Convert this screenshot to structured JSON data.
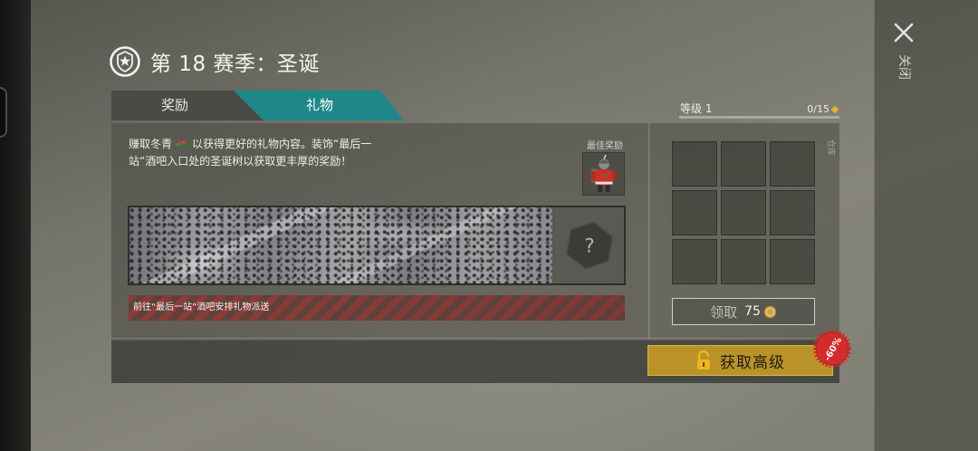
{
  "window": {
    "close_label": "关闭"
  },
  "header": {
    "title": "第 18 赛季：圣诞"
  },
  "tabs": [
    {
      "label": "奖励",
      "active": false
    },
    {
      "label": "礼物",
      "active": true
    }
  ],
  "gift": {
    "description_line1_before_icon": "赚取冬青",
    "description_line1_after_icon": "以获得更好的礼物内容。装饰“最后一",
    "description_line2": "站”酒吧入口处的圣诞树以获取更丰厚的奖励！",
    "best_reward_label": "最佳奖励",
    "mystery_symbol": "?",
    "delivery_notice": "前往“最后一站”酒吧安排礼物派送"
  },
  "level": {
    "label": "等级 1",
    "progress_text": "0/15",
    "progress_fraction": 0
  },
  "storage": {
    "label": "仓库"
  },
  "claim": {
    "label": "领取",
    "cost": "75"
  },
  "premium": {
    "label": "获取高级",
    "discount_badge": "-60%"
  },
  "colors": {
    "tab_active": "#1e8789",
    "premium_button": "#b99327",
    "discount_badge": "#d42b2b",
    "currency": "#e6b42a"
  },
  "icons": {
    "close": "close-icon",
    "season_badge": "season-badge-icon",
    "holly": "holly-icon",
    "level_currency": "diamond-icon",
    "claim_currency": "coin-icon",
    "premium": "unlock-icon",
    "mystery": "hexagon-question-icon"
  }
}
